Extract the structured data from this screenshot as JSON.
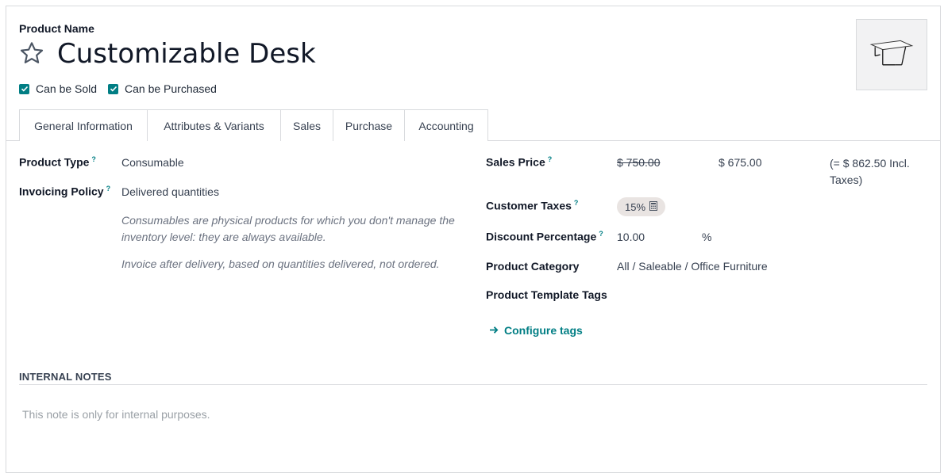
{
  "header": {
    "product_name_label": "Product Name",
    "title": "Customizable Desk",
    "favorite_icon": "star-outline-icon",
    "checkboxes": [
      {
        "label": "Can be Sold",
        "checked": true
      },
      {
        "label": "Can be Purchased",
        "checked": true
      }
    ],
    "image_alt": "desk-image"
  },
  "tabs": [
    {
      "label": "General Information",
      "active": true
    },
    {
      "label": "Attributes & Variants",
      "active": false
    },
    {
      "label": "Sales",
      "active": false
    },
    {
      "label": "Purchase",
      "active": false
    },
    {
      "label": "Accounting",
      "active": false
    }
  ],
  "left": {
    "product_type": {
      "label": "Product Type",
      "help": "?",
      "value": "Consumable"
    },
    "invoicing_policy": {
      "label": "Invoicing Policy",
      "help": "?",
      "value": "Delivered quantities"
    },
    "help_text_1": "Consumables are physical products for which you don't manage the inventory level: they are always available.",
    "help_text_2": "Invoice after delivery, based on quantities delivered, not ordered."
  },
  "right": {
    "sales_price": {
      "label": "Sales Price",
      "help": "?",
      "original": "$ 750.00",
      "discounted": "$ 675.00",
      "incl_taxes": "(= $ 862.50 Incl. Taxes)"
    },
    "customer_taxes": {
      "label": "Customer Taxes",
      "help": "?",
      "tag": "15%",
      "tag_icon": "calculator-icon"
    },
    "discount": {
      "label": "Discount Percentage",
      "help": "?",
      "value": "10.00",
      "unit": "%"
    },
    "category": {
      "label": "Product Category",
      "value": "All / Saleable / Office Furniture"
    },
    "tags": {
      "label": "Product Template Tags"
    },
    "configure_tags": {
      "label": "Configure tags",
      "icon": "arrow-right-icon"
    }
  },
  "notes": {
    "title": "INTERNAL NOTES",
    "placeholder": "This note is only for internal purposes."
  },
  "colors": {
    "accent": "#017e84",
    "badge_bg": "#e9e4e2",
    "border": "#d8dadd"
  }
}
